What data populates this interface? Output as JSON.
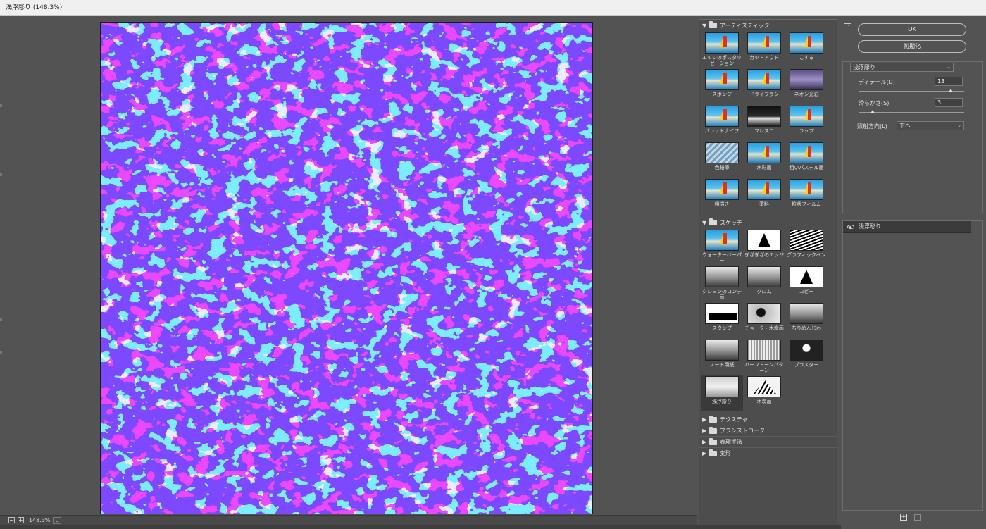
{
  "window": {
    "title": "浅浮彫り (148.3%)"
  },
  "zoom": {
    "value": "148.3%",
    "minus": "−",
    "plus": "+",
    "dropdown": "⌄"
  },
  "gallery": {
    "categories": [
      {
        "name": "アーティスティック",
        "expanded": true,
        "items": [
          {
            "label": "エッジのポスタリゼーション",
            "thumb": "img-color"
          },
          {
            "label": "カットアウト",
            "thumb": "img-color"
          },
          {
            "label": "こする",
            "thumb": "img-color"
          },
          {
            "label": "スポンジ",
            "thumb": "img-color"
          },
          {
            "label": "ドライブラシ",
            "thumb": "img-color"
          },
          {
            "label": "ネオン光彩",
            "thumb": "img-neon"
          },
          {
            "label": "パレットナイフ",
            "thumb": "img-color"
          },
          {
            "label": "フレスコ",
            "thumb": "img-dark"
          },
          {
            "label": "ラップ",
            "thumb": "img-color"
          },
          {
            "label": "色鉛筆",
            "thumb": "img-pencil"
          },
          {
            "label": "水彩画",
            "thumb": "img-color"
          },
          {
            "label": "粗いパステル画",
            "thumb": "img-color"
          },
          {
            "label": "粗描き",
            "thumb": "img-color"
          },
          {
            "label": "塗料",
            "thumb": "img-color"
          },
          {
            "label": "粒状フィルム",
            "thumb": "img-color"
          }
        ]
      },
      {
        "name": "スケッチ",
        "expanded": true,
        "items": [
          {
            "label": "ウォーターペーパー",
            "thumb": "img-color"
          },
          {
            "label": "ぎざぎざのエッジ",
            "thumb": "img-bw"
          },
          {
            "label": "グラフィックペン",
            "thumb": "img-bw2"
          },
          {
            "label": "クレヨンのコンテ画",
            "thumb": "img-gray"
          },
          {
            "label": "クロム",
            "thumb": "img-gray"
          },
          {
            "label": "コピー",
            "thumb": "img-bw"
          },
          {
            "label": "スタンプ",
            "thumb": "img-stamp"
          },
          {
            "label": "チョーク・木炭画",
            "thumb": "img-gray2"
          },
          {
            "label": "ちりめんじわ",
            "thumb": "img-gray"
          },
          {
            "label": "ノート用紙",
            "thumb": "img-gray"
          },
          {
            "label": "ハーフトーンパターン",
            "thumb": "img-half"
          },
          {
            "label": "プラスター",
            "thumb": "img-plaster"
          },
          {
            "label": "浅浮彫り",
            "thumb": "img-bas",
            "selected": true
          },
          {
            "label": "木炭画",
            "thumb": "img-charcoal"
          }
        ]
      },
      {
        "name": "テクスチャ",
        "expanded": false
      },
      {
        "name": "ブラシストローク",
        "expanded": false
      },
      {
        "name": "表現手法",
        "expanded": false
      },
      {
        "name": "変形",
        "expanded": false
      }
    ]
  },
  "settings": {
    "ok_label": "OK",
    "reset_label": "初期化",
    "collapse_icon": "⌃",
    "filter_select": "浅浮彫り",
    "detail": {
      "label": "ディテール(D)",
      "value": "13",
      "fraction": 0.87
    },
    "smoothness": {
      "label": "滑らかさ(S)",
      "value": "3",
      "fraction": 0.13
    },
    "light": {
      "label": "照射方向(L) :",
      "value": "下へ"
    }
  },
  "layers": {
    "name": "浅浮彫り"
  },
  "colors": {
    "canvas_blue": "#3411ff",
    "canvas_light": "#d4d8f8"
  }
}
